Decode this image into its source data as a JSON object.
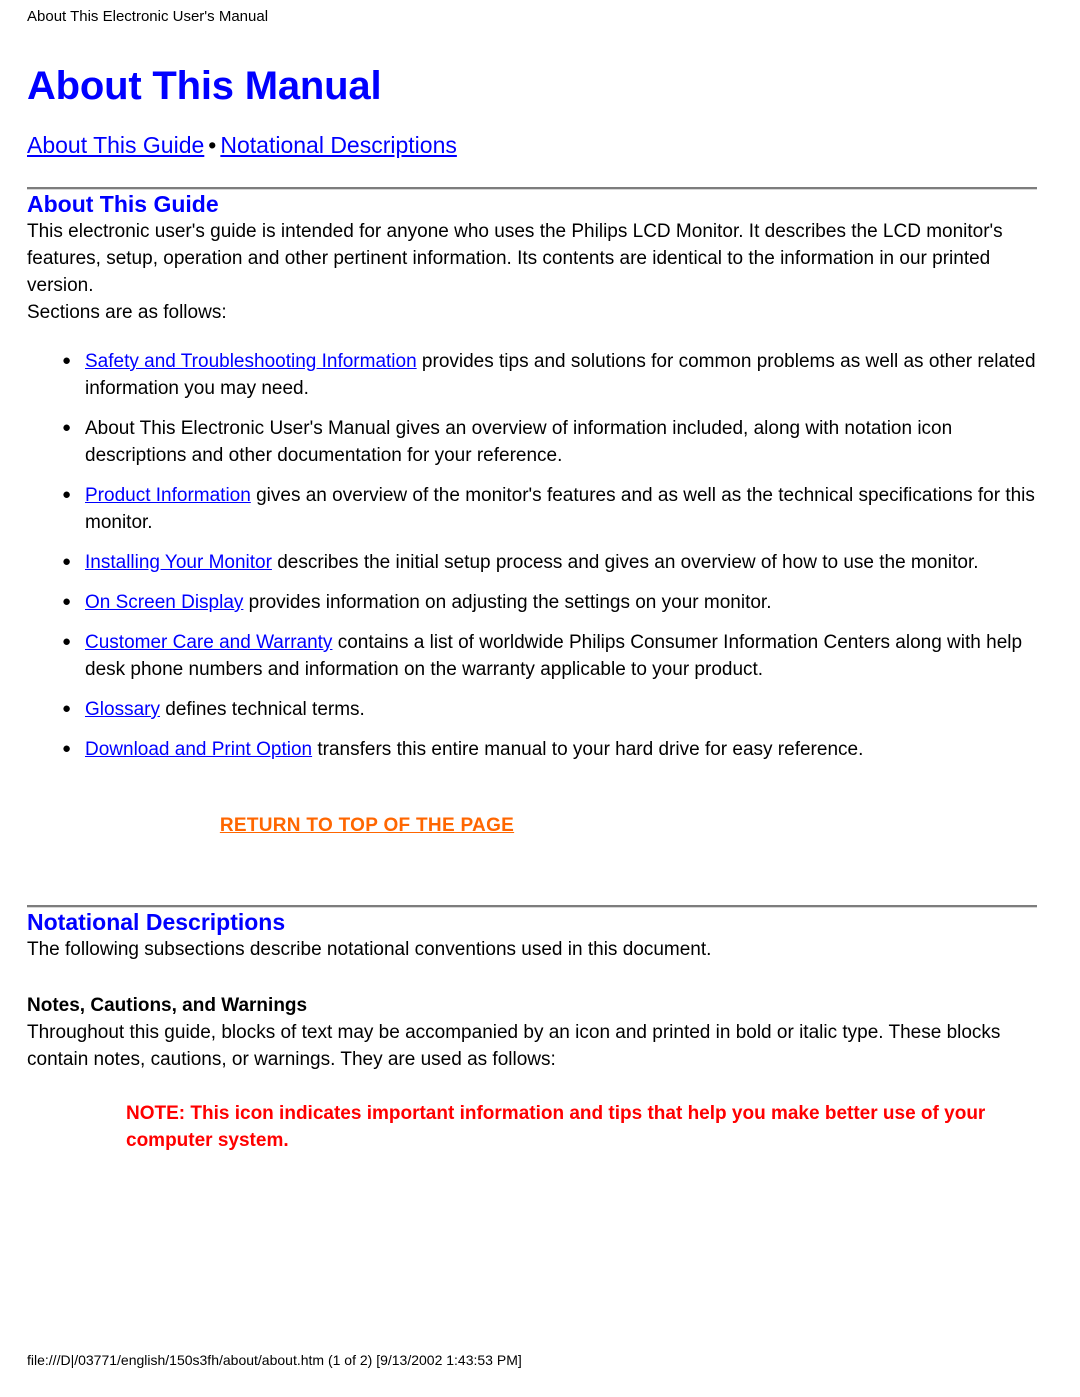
{
  "running_header": "About This Electronic User's Manual",
  "title": "About This Manual",
  "nav": {
    "separator": "•",
    "links": [
      "About This Guide",
      "Notational Descriptions"
    ]
  },
  "section_about_guide": {
    "heading": "About This Guide",
    "intro": "This electronic user's guide is intended for anyone who uses the Philips LCD Monitor. It describes the LCD monitor's features, setup, operation and other pertinent information. Its contents are identical to the information in our printed version.",
    "sections_lead": "Sections are as follows:",
    "bullets": [
      {
        "link": "Safety and Troubleshooting Information",
        "text": " provides tips and solutions for common problems as well as other related information you may need."
      },
      {
        "link": "",
        "text": "About This Electronic User's Manual gives an overview of information included, along with notation icon descriptions and other documentation for your reference."
      },
      {
        "link": "Product Information",
        "text": " gives an overview of the monitor's features and as well as the technical specifications for this monitor."
      },
      {
        "link": "Installing Your Monitor",
        "text": " describes the initial setup process and gives an overview of how to use the monitor."
      },
      {
        "link": "On Screen Display",
        "text": " provides information on adjusting the settings on your monitor."
      },
      {
        "link": "Customer Care and Warranty",
        "text": " contains a list of worldwide Philips Consumer Information Centers along with help desk phone numbers and information on the warranty applicable to your product."
      },
      {
        "link": "Glossary",
        "text": " defines technical terms."
      },
      {
        "link": "Download and Print Option",
        "text": " transfers this entire manual to your hard drive for easy reference."
      }
    ],
    "return_to_top": "RETURN TO TOP OF THE PAGE"
  },
  "section_notational": {
    "heading": "Notational Descriptions",
    "intro": "The following subsections describe notational conventions used in this document.",
    "subheading": "Notes, Cautions, and Warnings",
    "body": "Throughout this guide, blocks of text may be accompanied by an icon and printed in bold or italic type. These blocks contain notes, cautions, or warnings. They are used as follows:",
    "note": "NOTE: This icon indicates important information and tips that help you make better use of your computer system."
  },
  "footer": "file:///D|/03771/english/150s3fh/about/about.htm (1 of 2) [9/13/2002 1:43:53 PM]",
  "colors": {
    "heading_blue": "#0000ff",
    "link_blue": "#0000ff",
    "return_top_orange": "#ff6600",
    "note_red": "#ff0000",
    "rule_gray": "#7d7d7d"
  }
}
